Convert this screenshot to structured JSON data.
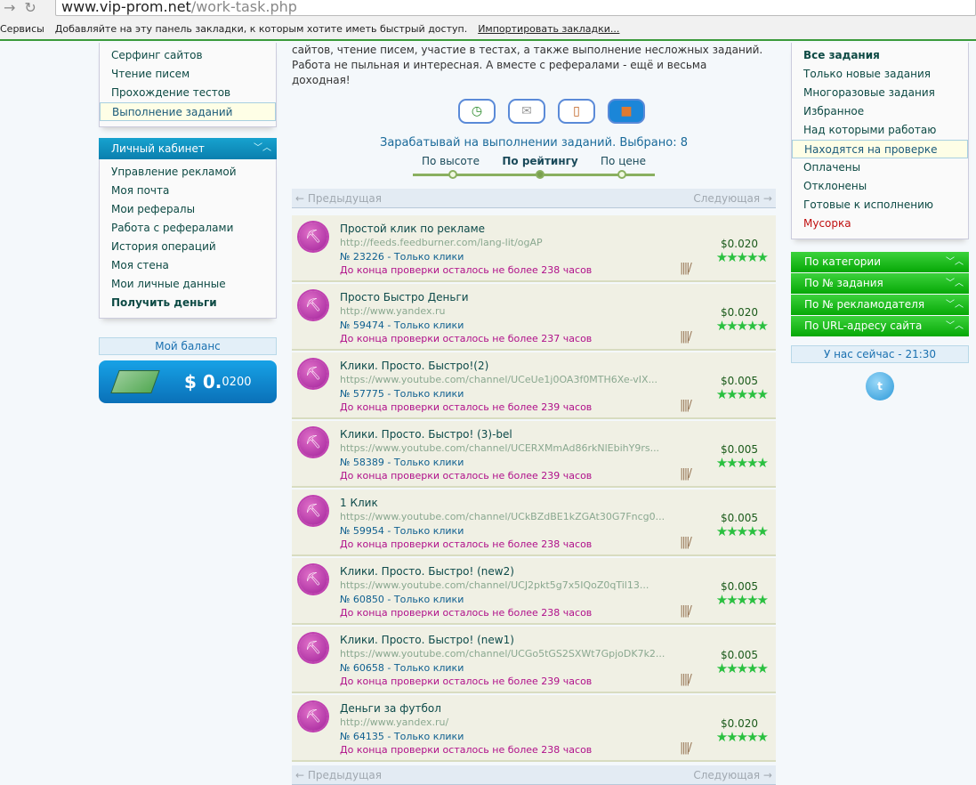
{
  "browser": {
    "url_host": "www.vip-prom.net",
    "url_path": "/work-task.php",
    "bookmarks_services": "Сервисы",
    "bookmarks_hint": "Добавляйте на эту панель закладки, к которым хотите иметь быстрый доступ.",
    "bookmarks_import": "Импортировать закладки..."
  },
  "left": {
    "earn_menu": [
      "Серфинг сайтов",
      "Чтение писем",
      "Прохождение тестов",
      "Выполнение заданий"
    ],
    "cabinet_title": "Личный кабинет",
    "cabinet_menu": [
      "Управление рекламой",
      "Моя почта",
      "Мои рефералы",
      "Работа с рефералами",
      "История операций",
      "Моя стена",
      "Мои личные данные",
      "Получить деньги"
    ],
    "balance_label": "Мой баланс",
    "balance_main": "$ 0.",
    "balance_small": "0200"
  },
  "center": {
    "intro": "сайтов, чтение писем, участие в тестах, а также выполнение несложных заданий. Работа не пыльная и интересная. А вместе с рефералами - ещё и весьма доходная!",
    "headline": "Зарабатывай на выполнении заданий. Выбрано: 8",
    "sort": [
      "По высоте",
      "По рейтингу",
      "По цене"
    ],
    "prev": "← Предыдущая",
    "next": "Следующая →",
    "tasks": [
      {
        "title": "Простой клик по рекламе",
        "url": "http://feeds.feedburner.com/lang-lit/ogAP",
        "id": "№ 23226 - Только клики",
        "deadline": "До конца проверки осталось не более 238 часов",
        "price": "$0.020",
        "rating": 5
      },
      {
        "title": "Просто Быстро Деньги",
        "url": "http://www.yandex.ru",
        "id": "№ 59474 - Только клики",
        "deadline": "До конца проверки осталось не более 237 часов",
        "price": "$0.020",
        "rating": 5
      },
      {
        "title": "Клики. Просто. Быстро!(2)",
        "url": "https://www.youtube.com/channel/UCeUe1j0OA3f0MTH6Xe-vIX...",
        "id": "№ 57775 - Только клики",
        "deadline": "До конца проверки осталось не более 239 часов",
        "price": "$0.005",
        "rating": 5
      },
      {
        "title": "Клики. Просто. Быстро! (3)-bel",
        "url": "https://www.youtube.com/channel/UCERXMmAd86rkNlEbihY9rs...",
        "id": "№ 58389 - Только клики",
        "deadline": "До конца проверки осталось не более 239 часов",
        "price": "$0.005",
        "rating": 5
      },
      {
        "title": "1 Клик",
        "url": "https://www.youtube.com/channel/UCkBZdBE1kZGAt30G7Fncg0...",
        "id": "№ 59954 - Только клики",
        "deadline": "До конца проверки осталось не более 238 часов",
        "price": "$0.005",
        "rating": 5
      },
      {
        "title": "Клики. Просто. Быстро! (new2)",
        "url": "https://www.youtube.com/channel/UCJ2pkt5g7x5IQoZ0qTil13...",
        "id": "№ 60850 - Только клики",
        "deadline": "До конца проверки осталось не более 238 часов",
        "price": "$0.005",
        "rating": 5
      },
      {
        "title": "Клики. Просто. Быстро! (new1)",
        "url": "https://www.youtube.com/channel/UCGo5tGS2SXWt7GpjoDK7k2...",
        "id": "№ 60658 - Только клики",
        "deadline": "До конца проверки осталось не более 239 часов",
        "price": "$0.005",
        "rating": 5
      },
      {
        "title": "Деньги за футбол",
        "url": "http://www.yandex.ru/",
        "id": "№ 64135 - Только клики",
        "deadline": "До конца проверки осталось не более 238 часов",
        "price": "$0.020",
        "rating": 5
      }
    ]
  },
  "right": {
    "filters": [
      "Все задания",
      "Только новые задания",
      "Многоразовые задания",
      "Избранное",
      "Над которыми работаю",
      "Находятся на проверке",
      "Оплачены",
      "Отклонены",
      "Готовые к исполнению",
      "Мусорка"
    ],
    "search": [
      "По категории",
      "По № задания",
      "По № рекламодателя",
      "По URL-адресу сайта"
    ],
    "now": "У нас сейчас - 21:30"
  }
}
